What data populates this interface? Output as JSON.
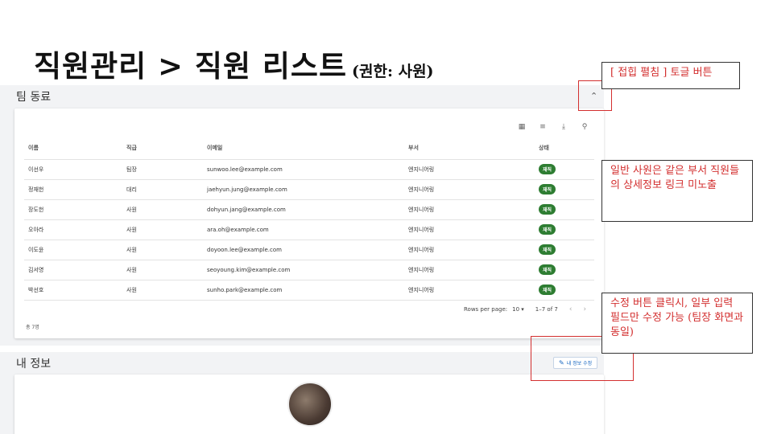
{
  "slide": {
    "title": "직원관리 > 직원 리스트",
    "subtitle": "(권한: 사원)"
  },
  "team": {
    "section_title": "팀 동료",
    "toolbar_icons": [
      "columns-icon",
      "filter-icon",
      "download-icon",
      "search-icon"
    ],
    "columns": [
      "이름",
      "직급",
      "이메일",
      "부서",
      "상태"
    ],
    "rows": [
      {
        "name": "이선우",
        "rank": "팀장",
        "email": "sunwoo.lee@example.com",
        "dept": "엔지니어링",
        "status": "재직"
      },
      {
        "name": "정재헌",
        "rank": "대리",
        "email": "jaehyun.jung@example.com",
        "dept": "엔지니어링",
        "status": "재직"
      },
      {
        "name": "장도헌",
        "rank": "사원",
        "email": "dohyun.jang@example.com",
        "dept": "엔지니어링",
        "status": "재직"
      },
      {
        "name": "오아라",
        "rank": "사원",
        "email": "ara.oh@example.com",
        "dept": "엔지니어링",
        "status": "재직"
      },
      {
        "name": "이도윤",
        "rank": "사원",
        "email": "doyoon.lee@example.com",
        "dept": "엔지니어링",
        "status": "재직"
      },
      {
        "name": "김서영",
        "rank": "사원",
        "email": "seoyoung.kim@example.com",
        "dept": "엔지니어링",
        "status": "재직"
      },
      {
        "name": "박선호",
        "rank": "사원",
        "email": "sunho.park@example.com",
        "dept": "엔지니어링",
        "status": "재직"
      }
    ],
    "pagination": {
      "rows_per_page_label": "Rows per page:",
      "rows_per_page_value": "10",
      "range": "1–7 of 7"
    },
    "total": "총 7명",
    "status_color": "#2e7d32"
  },
  "my_info": {
    "section_title": "내 정보",
    "edit_label": "내 정보 수정"
  },
  "notes": {
    "toggle": "[ 접힙 펼침 ] 토글 버튼",
    "link_hidden": "일반 사원은 같은 부서 직원들의 상세정보 링크 미노출",
    "edit_scope": "수정 버튼 클릭시, 일부 입력 필드만 수정 가능 (팀장 화면과 동일)"
  },
  "accent_color": "#d32f2f"
}
